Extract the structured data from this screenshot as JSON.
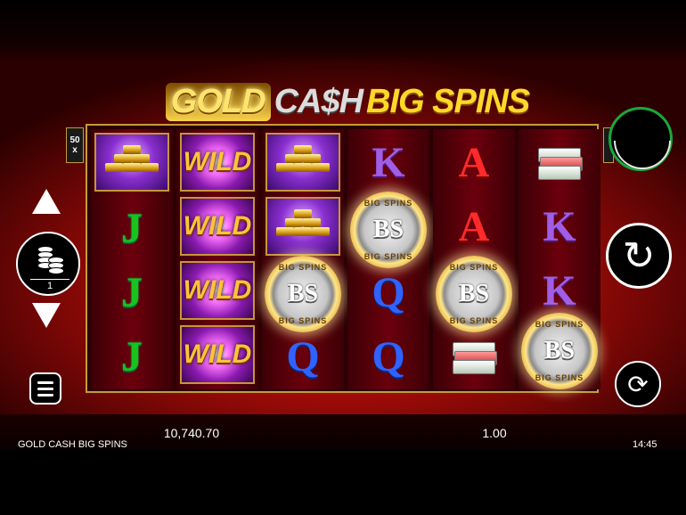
{
  "logo": {
    "word1": "GOLD",
    "word2": "CA$H",
    "word3": "BIG SPINS"
  },
  "badge": {
    "multiplier_top": "50",
    "multiplier_bottom": "x"
  },
  "coin": {
    "text": "BS",
    "ring_text": "BIG SPINS"
  },
  "wild_label": "WILD",
  "stake": {
    "value": "1"
  },
  "status": {
    "balance": "10,740.70",
    "bet": "1.00",
    "game_title": "GOLD CASH BIG SPINS",
    "clock": "14:45"
  },
  "buttons": {
    "spin_icon": "↻",
    "autoplay_icon": "⟳"
  },
  "reels": [
    [
      "gold-bar",
      "J",
      "J",
      "J"
    ],
    [
      "wild",
      "wild",
      "wild",
      "wild"
    ],
    [
      "gold-bar",
      "gold-bar",
      "coin",
      "Q"
    ],
    [
      "K",
      "coin",
      "Q",
      "Q"
    ],
    [
      "A",
      "A",
      "coin",
      "cash"
    ],
    [
      "cash",
      "K",
      "K",
      "coin"
    ]
  ],
  "colors": {
    "frame": "#c69a3a",
    "background": "#a50c08",
    "autoplay_ring": "#1aa83a"
  }
}
